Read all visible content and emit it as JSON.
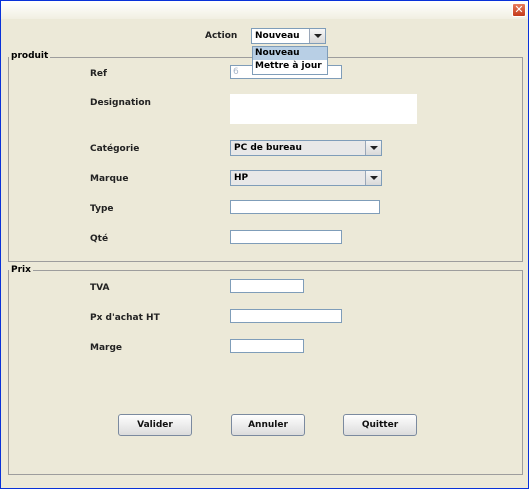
{
  "window": {
    "close_symbol": "✕"
  },
  "action": {
    "label": "Action",
    "selected": "Nouveau",
    "options": [
      "Nouveau",
      "Mettre à jour"
    ]
  },
  "produit": {
    "legend": "produit",
    "ref_label": "Ref",
    "ref_value": "6",
    "designation_label": "Designation",
    "designation_value": "",
    "categorie_label": "Catégorie",
    "categorie_value": "PC de bureau",
    "marque_label": "Marque",
    "marque_value": "HP",
    "type_label": "Type",
    "type_value": "",
    "qte_label": "Qté",
    "qte_value": ""
  },
  "prix": {
    "legend": "Prix",
    "tva_label": "TVA",
    "tva_value": "",
    "px_achat_label": "Px d'achat HT",
    "px_achat_value": "",
    "marge_label": "Marge",
    "marge_value": ""
  },
  "buttons": {
    "valider": "Valider",
    "annuler": "Annuler",
    "quitter": "Quitter"
  }
}
